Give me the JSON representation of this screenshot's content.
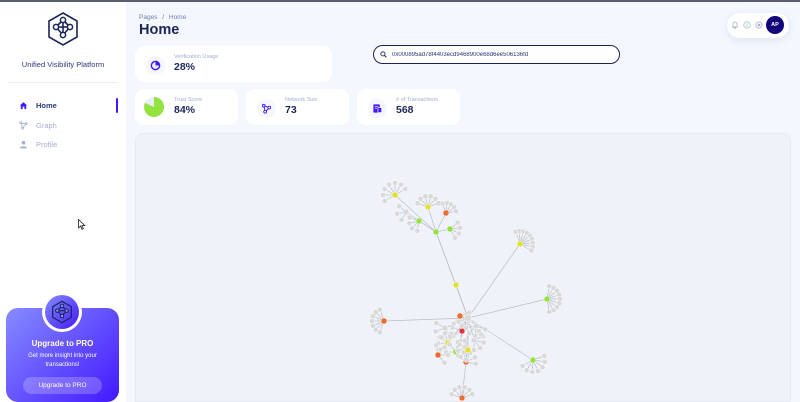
{
  "app": {
    "name": "Unified Visibility Platform"
  },
  "nav": [
    {
      "label": "Home",
      "icon": "home-icon",
      "active": true
    },
    {
      "label": "Graph",
      "icon": "graph-icon",
      "active": false
    },
    {
      "label": "Profile",
      "icon": "person-icon",
      "active": false
    }
  ],
  "upgrade": {
    "title": "Upgrade to PRO",
    "text": "Get more insight into your transactions!",
    "button": "Upgrade to PRO"
  },
  "header": {
    "breadcrumb_root": "Pages",
    "breadcrumb_sep": "/",
    "breadcrumb_current": "Home",
    "title": "Home"
  },
  "user": {
    "initials": "AP"
  },
  "search": {
    "value": "0x000895ad78f4403ecd9468900e68d6ee506136fd"
  },
  "stats": [
    {
      "label": "Verification Usage",
      "value": "28%",
      "icon": "usage-pie-icon"
    },
    {
      "label": "Trust Score",
      "value": "84%",
      "icon": "trust-pie-icon"
    },
    {
      "label": "Network Size",
      "value": "73",
      "icon": "network-icon"
    },
    {
      "label": "# of Transactions",
      "value": "568",
      "icon": "transactions-icon"
    }
  ],
  "colors": {
    "accent": "#4318ff",
    "node_gray": "#d9d9d9",
    "node_yellow": "#e3df2d",
    "node_green": "#94e23f",
    "node_orange": "#ee6a2f",
    "node_red": "#e3323c"
  }
}
